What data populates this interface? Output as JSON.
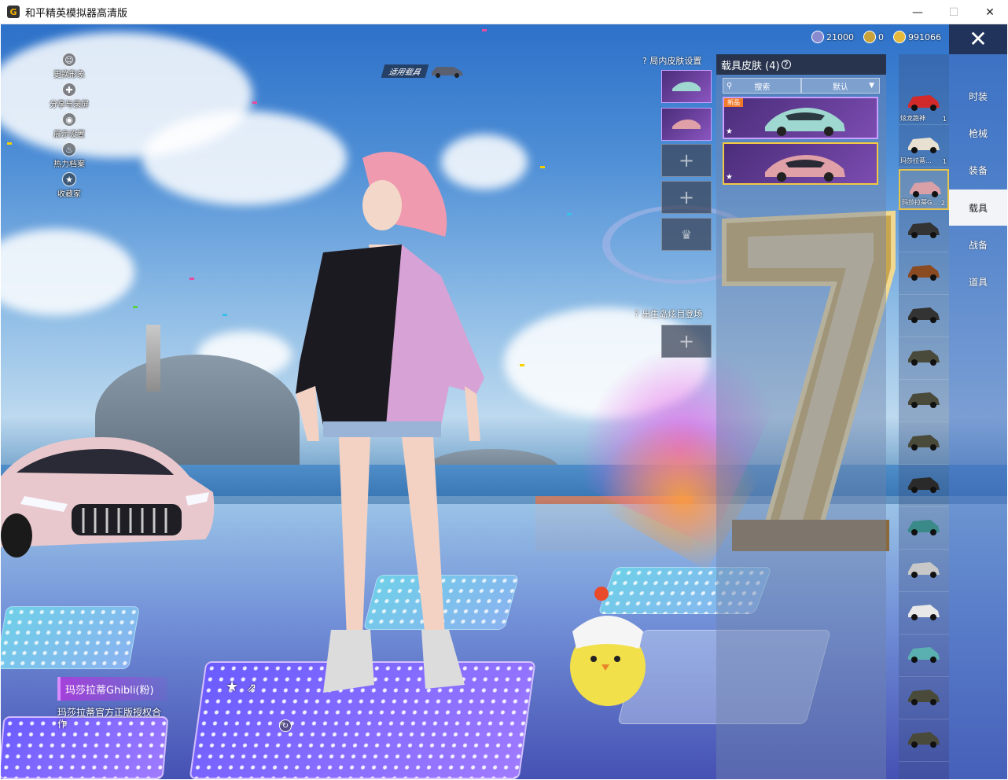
{
  "window": {
    "title": "和平精英模拟器高清版",
    "icon_letter": "G",
    "controls": {
      "minimize": "—",
      "maximize": "☐",
      "close": "✕"
    }
  },
  "currency": [
    {
      "name": "gem",
      "value": "21000",
      "color": "#8a8ad0"
    },
    {
      "name": "coupon",
      "value": "0",
      "color": "#c9a23a"
    },
    {
      "name": "gold",
      "value": "991066",
      "color": "#e5b93b"
    }
  ],
  "close_glyph": "✕",
  "left_menu": [
    {
      "label": "更换形象",
      "icon": "person-icon",
      "glyph": "☺"
    },
    {
      "label": "分享与录屏",
      "icon": "share-record-icon",
      "glyph": "✚"
    },
    {
      "label": "展示设置",
      "icon": "eye-icon",
      "glyph": "◉"
    },
    {
      "label": "热力档案",
      "icon": "flame-icon",
      "glyph": "♨"
    },
    {
      "label": "收藏家",
      "icon": "collector-icon",
      "glyph": "★"
    }
  ],
  "apply_tag": "适用载具",
  "category_tabs": [
    {
      "label": "时装",
      "active": false
    },
    {
      "label": "枪械",
      "active": false
    },
    {
      "label": "装备",
      "active": false
    },
    {
      "label": "载具",
      "active": true
    },
    {
      "label": "战备",
      "active": false
    },
    {
      "label": "道具",
      "active": false
    }
  ],
  "vehicles": [
    {
      "name": "炫龙跑神",
      "count": "1",
      "color": "#d22a2a",
      "selected": false
    },
    {
      "name": "玛莎拉蒂...",
      "count": "1",
      "color": "#e8e0d0",
      "selected": false
    },
    {
      "name": "玛莎拉蒂G...",
      "count": "2",
      "color": "#d9a0a8",
      "selected": true
    },
    {
      "name": "",
      "count": "",
      "color": "#333333",
      "selected": false
    },
    {
      "name": "",
      "count": "",
      "color": "#8a4a22",
      "selected": false
    },
    {
      "name": "",
      "count": "",
      "color": "#333333",
      "selected": false
    },
    {
      "name": "",
      "count": "",
      "color": "#4a4a3a",
      "selected": false
    },
    {
      "name": "",
      "count": "",
      "color": "#4a4a3a",
      "selected": false
    },
    {
      "name": "",
      "count": "",
      "color": "#4a4a3a",
      "selected": false
    },
    {
      "name": "",
      "count": "",
      "color": "#2a2a2a",
      "selected": false
    },
    {
      "name": "",
      "count": "",
      "color": "#3a8a8a",
      "selected": false
    },
    {
      "name": "",
      "count": "",
      "color": "#c8c8c8",
      "selected": false
    },
    {
      "name": "",
      "count": "",
      "color": "#e8e8e8",
      "selected": false
    },
    {
      "name": "",
      "count": "",
      "color": "#5ab0b0",
      "selected": false
    },
    {
      "name": "",
      "count": "",
      "color": "#4a4a3a",
      "selected": false
    },
    {
      "name": "",
      "count": "",
      "color": "#4a4a3a",
      "selected": false
    }
  ],
  "skin_panel": {
    "title": "载具皮肤 (4)",
    "help_glyph": "?",
    "search_placeholder": "搜索",
    "sort_label": "默认",
    "cards": [
      {
        "badge": "新品",
        "color": "#9fd8d0",
        "selected": false
      },
      {
        "badge": "",
        "color": "#e0a0a8",
        "selected": true
      }
    ]
  },
  "inmatch": {
    "label": "局内皮肤设置",
    "help_glyph": "?",
    "slots": [
      {
        "filled": true,
        "color": "#9fd8d0"
      },
      {
        "filled": true,
        "color": "#e0a0a8"
      },
      {
        "filled": false
      },
      {
        "filled": false
      },
      {
        "filled": false,
        "crown": true
      }
    ]
  },
  "spawn": {
    "label": "出生岛炫目登场",
    "help_glyph": "?"
  },
  "skin_info": {
    "name": "玛莎拉蒂Ghibli(粉)",
    "desc": "玛莎拉蒂官方正版授权合作"
  }
}
